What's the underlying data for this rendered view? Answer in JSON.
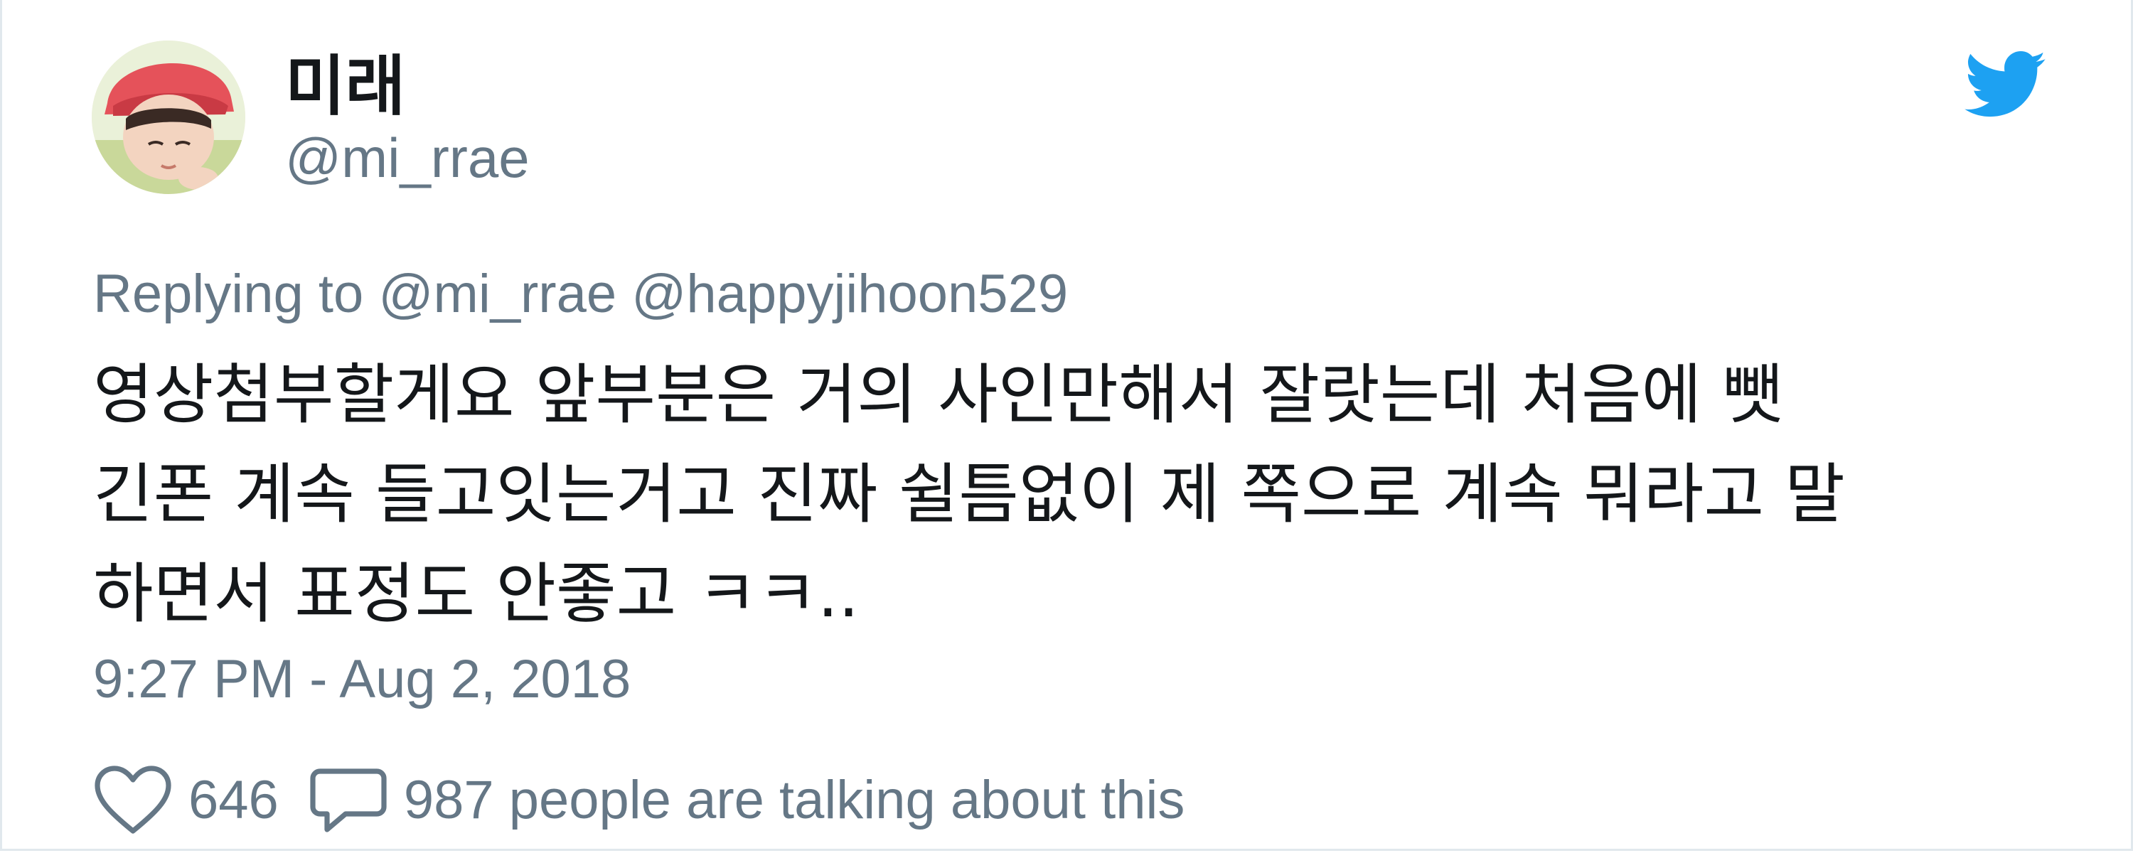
{
  "tweet": {
    "author": {
      "display_name": "미래",
      "handle": "@mi_rrae",
      "avatar_icon": "profile-photo"
    },
    "platform_icon": "twitter-bird-icon",
    "reply": {
      "prefix": "Replying to",
      "mentions": [
        "@mi_rrae",
        "@happyjihoon529"
      ]
    },
    "text_lines": [
      "영상첨부할게요 앞부분은 거의 사인만해서 잘랏는데 처음에 뺏",
      "긴폰 계속 들고잇는거고 진짜 쉴틈없이 제 쪽으로 계속 뭐라고 말",
      "하면서 표정도 안좋고 ㅋㅋ.."
    ],
    "timestamp": "9:27 PM - Aug 2, 2018",
    "likes": {
      "icon": "heart-icon",
      "count": "646"
    },
    "conversation": {
      "icon": "speech-bubble-icon",
      "text": "987 people are talking about this"
    }
  },
  "colors": {
    "text": "#14171a",
    "secondary": "#657786",
    "twitter_blue": "#1da1f2",
    "border": "#e1e8ed"
  }
}
